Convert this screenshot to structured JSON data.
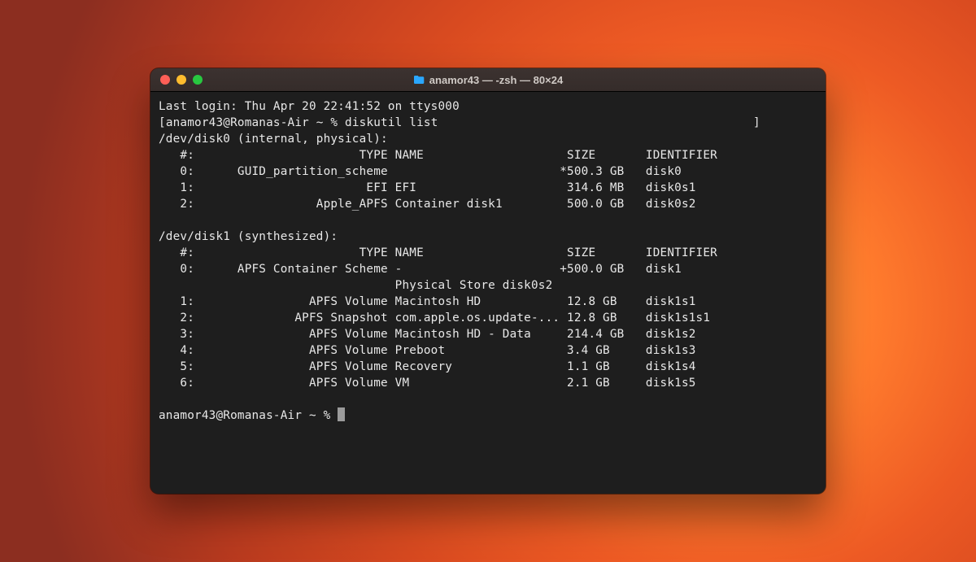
{
  "window": {
    "title": "anamor43 — -zsh — 80×24"
  },
  "session": {
    "last_login": "Last login: Thu Apr 20 22:41:52 on ttys000",
    "prompt_open_bracket": "[",
    "prompt_close_bracket": "]",
    "prompt_user_host": "anamor43@Romanas-Air ~ %",
    "command": "diskutil list",
    "prompt_idle": "anamor43@Romanas-Air ~ % "
  },
  "output": {
    "disk0": {
      "header": "/dev/disk0 (internal, physical):",
      "cols": "   #:                       TYPE NAME                    SIZE       IDENTIFIER",
      "rows": [
        "   0:      GUID_partition_scheme                        *500.3 GB   disk0",
        "   1:                        EFI EFI                     314.6 MB   disk0s1",
        "   2:                 Apple_APFS Container disk1         500.0 GB   disk0s2"
      ]
    },
    "disk1": {
      "header": "/dev/disk1 (synthesized):",
      "cols": "   #:                       TYPE NAME                    SIZE       IDENTIFIER",
      "rows": [
        "   0:      APFS Container Scheme -                      +500.0 GB   disk1",
        "                                 Physical Store disk0s2",
        "   1:                APFS Volume Macintosh HD            12.8 GB    disk1s1",
        "   2:              APFS Snapshot com.apple.os.update-... 12.8 GB    disk1s1s1",
        "   3:                APFS Volume Macintosh HD - Data     214.4 GB   disk1s2",
        "   4:                APFS Volume Preboot                 3.4 GB     disk1s3",
        "   5:                APFS Volume Recovery                1.1 GB     disk1s4",
        "   6:                APFS Volume VM                      2.1 GB     disk1s5"
      ]
    }
  }
}
